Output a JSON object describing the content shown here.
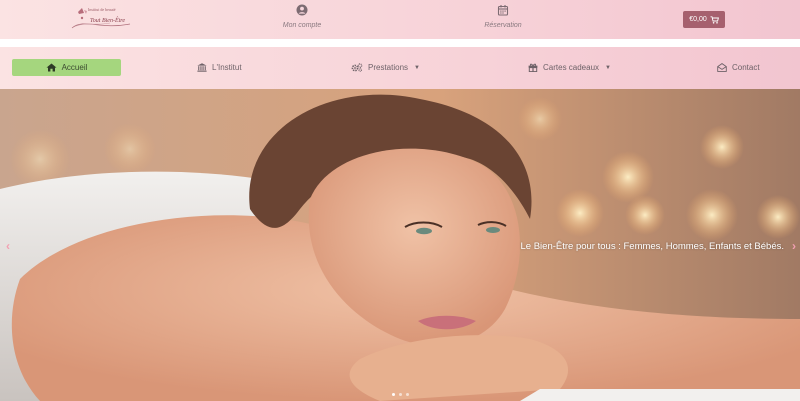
{
  "brand": {
    "tagline": "Institut de beauté",
    "name": "Tout Bien-Être"
  },
  "top_links": {
    "account": {
      "label": "Mon compte",
      "icon": "user-circle-icon"
    },
    "reservation": {
      "label": "Réservation",
      "icon": "calendar-icon"
    }
  },
  "cart": {
    "amount": "€0,00",
    "icon": "cart-icon"
  },
  "nav": {
    "home": {
      "label": "Accueil",
      "icon": "home-icon"
    },
    "institut": {
      "label": "L'Institut",
      "icon": "institution-icon"
    },
    "prestations": {
      "label": "Prestations",
      "icon": "gears-icon"
    },
    "cartes": {
      "label": "Cartes cadeaux",
      "icon": "gift-icon"
    },
    "contact": {
      "label": "Contact",
      "icon": "envelope-open-icon"
    }
  },
  "hero": {
    "caption": "Le Bien-Être pour tous : Femmes, Hommes, Enfants et Bébés.",
    "prev_arrow": "‹",
    "next_arrow": "›",
    "slide_count": 3,
    "active_slide": 1
  },
  "colors": {
    "header_pink": "#f7d2d8",
    "cart_button": "#a6606e",
    "home_active": "#a5d67e"
  }
}
